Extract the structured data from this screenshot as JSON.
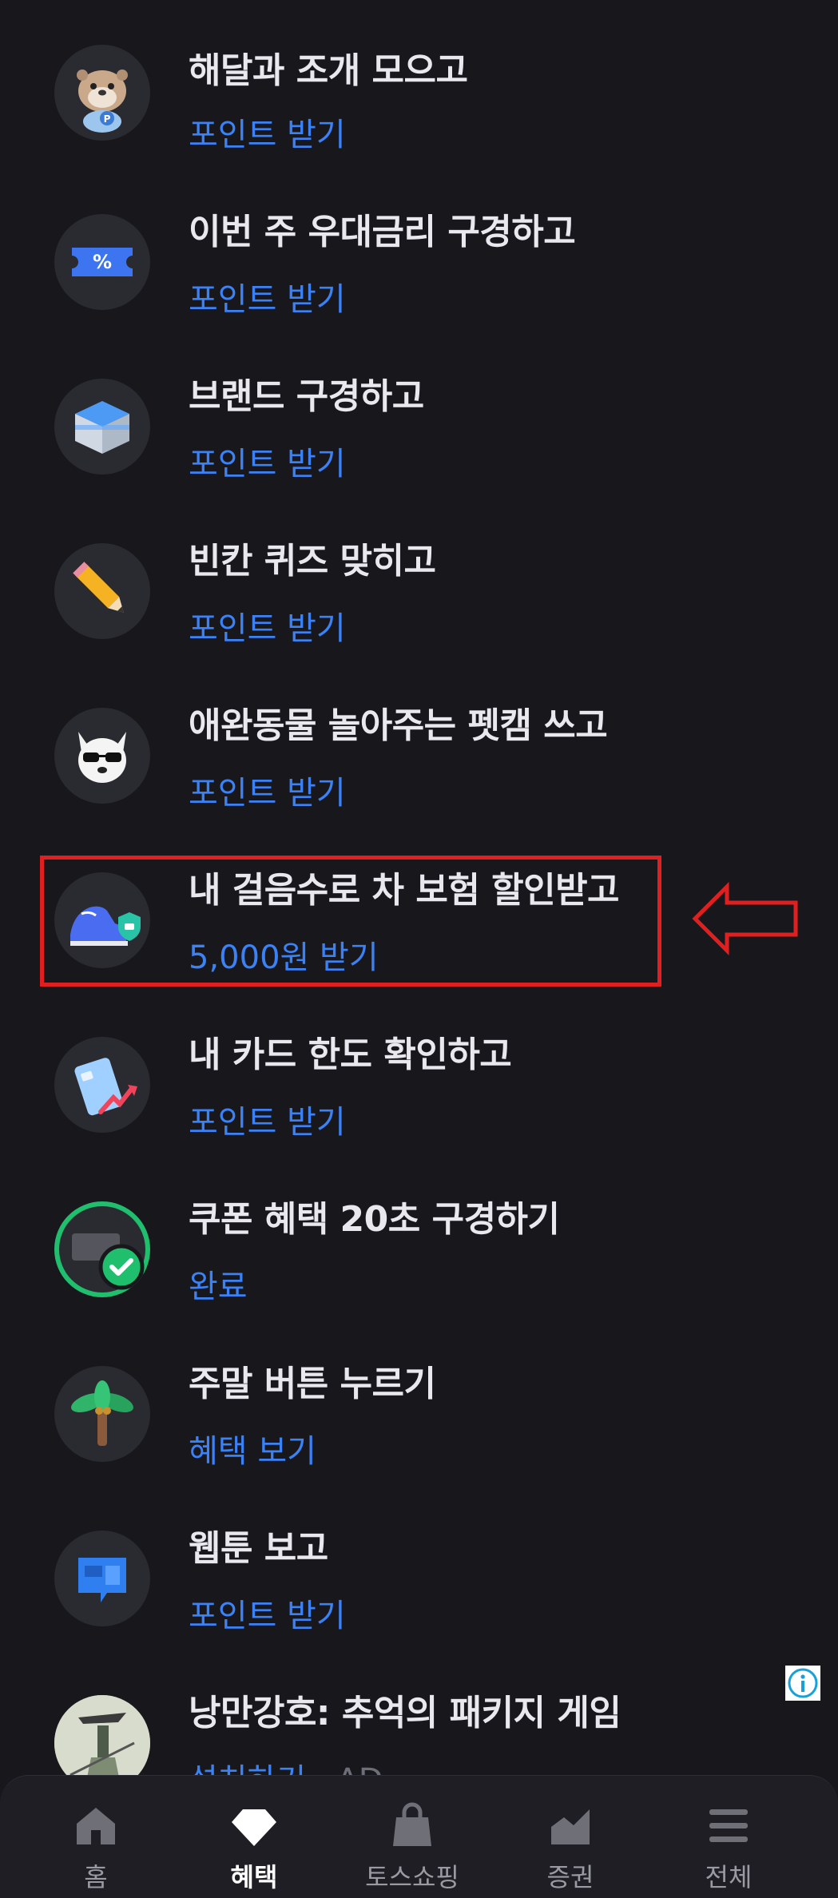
{
  "items": [
    {
      "title": "해달과 조개 모으고",
      "action": "포인트 받기",
      "icon": "otter-icon"
    },
    {
      "title": "이번 주 우대금리 구경하고",
      "action": "포인트 받기",
      "icon": "ticket-percent-icon"
    },
    {
      "title": "브랜드 구경하고",
      "action": "포인트 받기",
      "icon": "box-icon"
    },
    {
      "title": "빈칸 퀴즈 맞히고",
      "action": "포인트 받기",
      "icon": "pencil-icon"
    },
    {
      "title": "애완동물 놀아주는 펫캠 쓰고",
      "action": "포인트 받기",
      "icon": "dog-sunglasses-icon"
    },
    {
      "title": "내 걸음수로 차 보험 할인받고",
      "action": "5,000원 받기",
      "icon": "sneaker-shield-icon"
    },
    {
      "title": "내 카드 한도 확인하고",
      "action": "포인트 받기",
      "icon": "card-up-icon"
    },
    {
      "title": "쿠폰 혜택 20초 구경하기",
      "action": "완료",
      "icon": "coupon-check-icon"
    },
    {
      "title": "주말 버튼 누르기",
      "action": "혜택 보기",
      "icon": "palm-tree-icon"
    },
    {
      "title": "웹툰 보고",
      "action": "포인트 받기",
      "icon": "webtoon-icon"
    },
    {
      "title": "낭만강호: 추억의 패키지 게임",
      "action": "설치하기",
      "ad": "· AD",
      "icon": "game-thumbnail-icon"
    }
  ],
  "tabs": [
    {
      "label": "홈",
      "icon": "home-icon"
    },
    {
      "label": "혜택",
      "icon": "diamond-icon"
    },
    {
      "label": "토스쇼핑",
      "icon": "shopping-bag-icon"
    },
    {
      "label": "증권",
      "icon": "chart-icon"
    },
    {
      "label": "전체",
      "icon": "menu-icon"
    }
  ],
  "active_tab": "혜택",
  "colors": {
    "background": "#17171c",
    "accent": "#3b82f6",
    "highlight": "#e02020"
  }
}
